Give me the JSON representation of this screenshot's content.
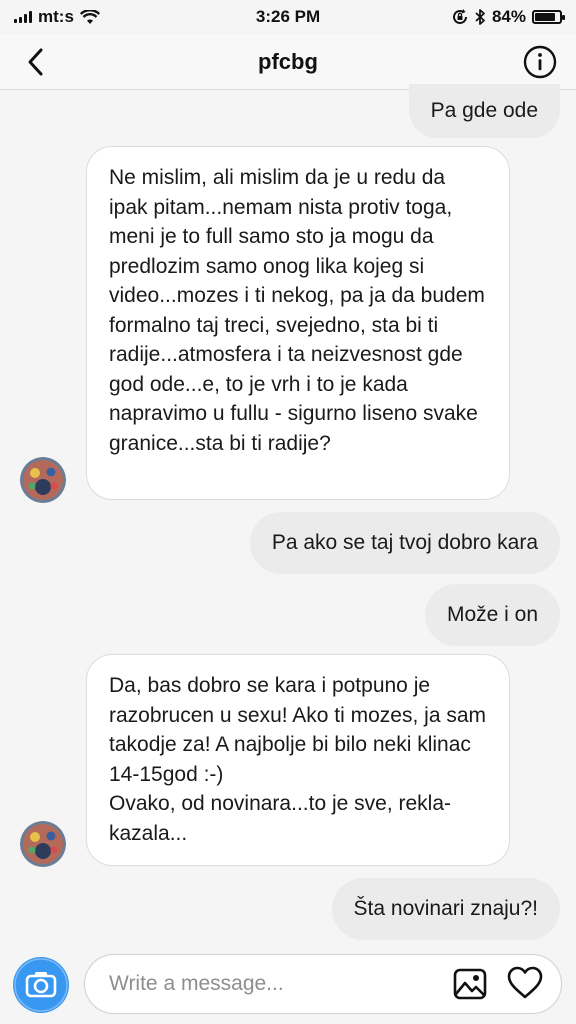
{
  "status_bar": {
    "carrier": "mt:s",
    "time": "3:26 PM",
    "battery_text": "84%",
    "battery_level": 0.84
  },
  "header": {
    "title": "pfcbg"
  },
  "messages": [
    {
      "direction": "outgoing",
      "text": "Pa gde ode"
    },
    {
      "direction": "incoming",
      "text": "Ne mislim, ali mislim da je u redu da ipak pitam...nemam nista protiv toga, meni je to full samo sto ja mogu da predlozim samo onog lika kojeg si video...mozes i ti nekog, pa ja da budem formalno taj treci, svejedno, sta bi ti radije...atmosfera i ta neizvesnost gde god ode...e, to je vrh i to je kada napravimo u fullu - sigurno liseno svake granice...sta bi ti radije?"
    },
    {
      "direction": "outgoing",
      "text": "Pa ako se taj tvoj dobro kara"
    },
    {
      "direction": "outgoing",
      "text": "Može i on"
    },
    {
      "direction": "incoming",
      "text": "Da, bas dobro se kara i potpuno je razobrucen u sexu! Ako ti mozes, ja sam takodje za! A najbolje bi bilo neki klinac 14-15god :-)\nOvako, od novinara...to je sve, rekla-kazala..."
    },
    {
      "direction": "outgoing",
      "text": "Šta novinari znaju?!"
    }
  ],
  "composer": {
    "placeholder": "Write a message..."
  },
  "icons": {
    "back": "chevron-left-icon",
    "info": "info-icon",
    "camera": "camera-icon",
    "gallery": "gallery-icon",
    "like": "heart-icon",
    "wifi": "wifi-icon",
    "bluetooth": "bluetooth-icon",
    "orientation_lock": "orientation-lock-icon"
  },
  "colors": {
    "outgoing_bubble": "#ebebeb",
    "incoming_bubble": "#ffffff",
    "camera_accent": "#3897f0"
  }
}
